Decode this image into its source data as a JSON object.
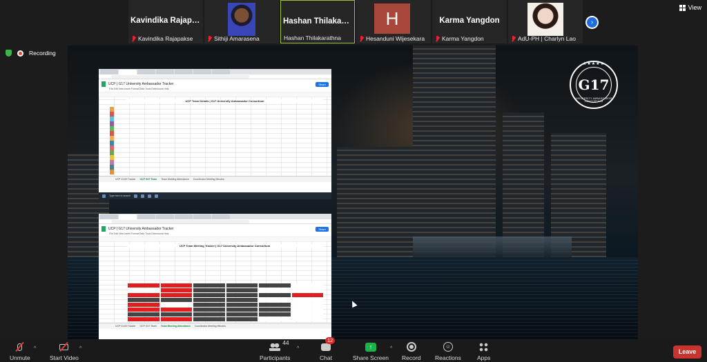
{
  "participants_strip": [
    {
      "big_name": "Kavindika Rajapakse",
      "label": "Kavindika Rajapakse",
      "video": false
    },
    {
      "big_name": "",
      "label": "Sithiji Amarasena",
      "video": true
    },
    {
      "big_name": "Hashan Thilakarathna",
      "label": "Hashan Thilakarathna",
      "video": false,
      "active": true
    },
    {
      "big_name": "",
      "avatar_letter": "H",
      "label": "Hesanduni Wijesekara",
      "video": false
    },
    {
      "big_name": "Karma Yangdon",
      "label": "Karma Yangdon",
      "video": false
    },
    {
      "big_name": "",
      "label": "AdU-PH | Charlyn Lao",
      "video": true
    }
  ],
  "strip_next_icon": "chevron-right-icon",
  "view_label": "View",
  "recording_label": "Recording",
  "logo": {
    "text": "G17",
    "ring_top": "★★★★★",
    "ring_bottom": "UNIVERSITY AMBASSADOR CONSORTIUM"
  },
  "sheets": [
    {
      "doc_title": "UCP | G17 University Ambassador Tracker",
      "share_label": "Share",
      "sheet_header": "UCP Team Details | G17 University Ambassador Consortium",
      "tabs": [
        "UCP G100 Tracker",
        "UCP G17 Team",
        "Team Meeting Attendance",
        "Coordinator Meeting Minutes"
      ],
      "active_tab": 1
    },
    {
      "doc_title": "UCP | G17 University Ambassador Tracker",
      "share_label": "Share",
      "sheet_header": "UCP Team Meeting Tracker | G17 University Ambassador Consortium",
      "tabs": [
        "UCP G100 Tracker",
        "UCP G17 Team",
        "Team Meeting Attendance",
        "Coordinator Meeting Minutes"
      ],
      "active_tab": 2
    }
  ],
  "taskbar_search": "Type here to search",
  "toolbar": {
    "unmute": "Unmute",
    "start_video": "Start Video",
    "participants": "Participants",
    "participants_count": "44",
    "chat": "Chat",
    "chat_badge": "12",
    "share_screen": "Share Screen",
    "record": "Record",
    "reactions": "Reactions",
    "apps": "Apps",
    "leave": "Leave"
  },
  "colors": {
    "accent_green": "#19b34a",
    "leave_red": "#c9342f",
    "active_border": "#9fc236",
    "mute_red": "#e23c39"
  }
}
